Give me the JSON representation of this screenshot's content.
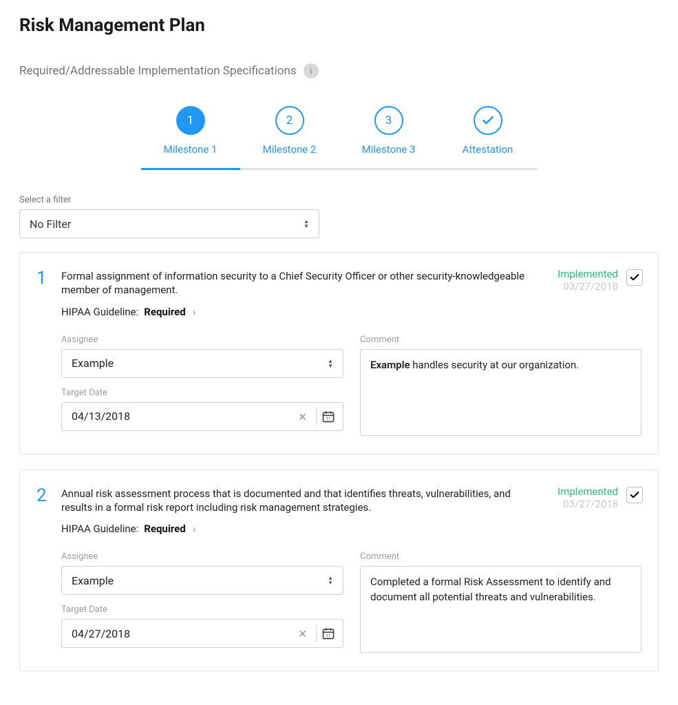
{
  "page": {
    "title": "Risk Management Plan",
    "subtitle": "Required/Addressable Implementation Specifications"
  },
  "stepper": {
    "steps": [
      {
        "num": "1",
        "label": "Milestone 1",
        "active": true
      },
      {
        "num": "2",
        "label": "Milestone 2",
        "active": false
      },
      {
        "num": "3",
        "label": "Milestone 3",
        "active": false
      },
      {
        "num": "✓",
        "label": "Attestation",
        "active": false,
        "icon": "check"
      }
    ]
  },
  "filter": {
    "label": "Select a filter",
    "value": "No Filter"
  },
  "items": [
    {
      "num": "1",
      "desc": "Formal assignment of information security to a Chief Security Officer or other security-knowledgeable member of management.",
      "guideline_label": "HIPAA Guideline:",
      "guideline_value": "Required",
      "status_label": "Implemented",
      "status_date": "03/27/2018",
      "assignee_label": "Assignee",
      "assignee_value": "Example",
      "target_label": "Target Date",
      "target_value": "04/13/2018",
      "comment_label": "Comment",
      "comment_bold": "Example",
      "comment_rest": " handles security at our organization."
    },
    {
      "num": "2",
      "desc": "Annual risk assessment process that is documented and that identifies threats, vulnerabilities, and results in a formal risk report including risk management strategies.",
      "guideline_label": "HIPAA Guideline:",
      "guideline_value": "Required",
      "status_label": "Implemented",
      "status_date": "03/27/2018",
      "assignee_label": "Assignee",
      "assignee_value": "Example",
      "target_label": "Target Date",
      "target_value": "04/27/2018",
      "comment_label": "Comment",
      "comment_bold": "",
      "comment_rest": "Completed a formal Risk Assessment to identify and document all potential threats and vulnerabilities."
    }
  ]
}
